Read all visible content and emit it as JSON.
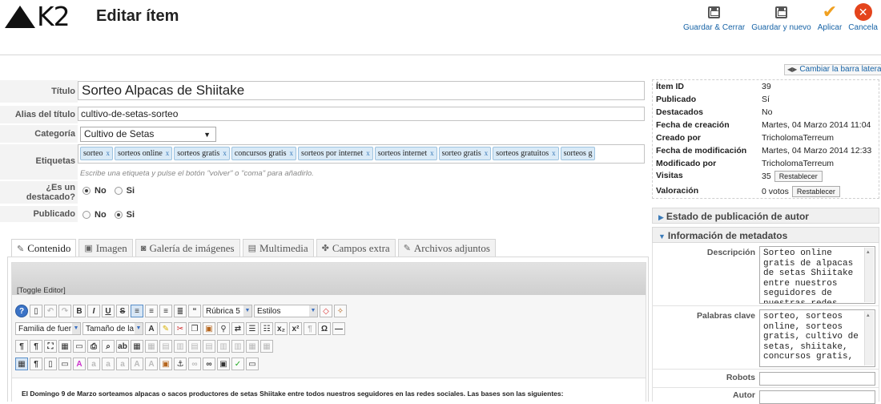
{
  "header": {
    "logo_text": "K2",
    "title": "Editar ítem",
    "toolbar": [
      {
        "label": "Guardar & Cerrar",
        "icon": "save-icon"
      },
      {
        "label": "Guardar y nuevo",
        "icon": "save-icon"
      },
      {
        "label": "Aplicar",
        "icon": "check-icon"
      },
      {
        "label": "Cancela",
        "icon": "cancel-icon"
      }
    ]
  },
  "sidebar_toggle": "Cambiar la barra lateral",
  "form": {
    "title_label": "Título",
    "title_value": "Sorteo Alpacas de Shiitake",
    "alias_label": "Alias del título",
    "alias_value": "cultivo-de-setas-sorteo",
    "category_label": "Categoría",
    "category_value": "Cultivo de Setas",
    "tags_label": "Etiquetas",
    "tags": [
      "sorteo",
      "sorteos online",
      "sorteos gratis",
      "concursos gratis",
      "sorteos por internet",
      "sorteos internet",
      "sorteo gratis",
      "sorteos gratuitos",
      "sorteos g"
    ],
    "tag_remove": "x",
    "tags_hint": "Escribe una etiqueta y pulse el botón \"volver\" o \"coma\" para añadirlo.",
    "featured_label_1": "¿Es un",
    "featured_label_2": "destacado?",
    "featured_no": "No",
    "featured_yes": "Si",
    "published_label": "Publicado",
    "published_no": "No",
    "published_yes": "Si"
  },
  "tabs": [
    {
      "label": "Contenido",
      "icon": "edit-icon"
    },
    {
      "label": "Imagen",
      "icon": "image-icon"
    },
    {
      "label": "Galería de imágenes",
      "icon": "camera-icon"
    },
    {
      "label": "Multimedia",
      "icon": "film-icon"
    },
    {
      "label": "Campos extra",
      "icon": "puzzle-icon"
    },
    {
      "label": "Archivos adjuntos",
      "icon": "paperclip-icon"
    }
  ],
  "editor": {
    "toggle_label": "[Toggle Editor]",
    "format_value": "Rúbrica 5",
    "styles_value": "Estilos",
    "font_family": "Familia de fuer",
    "font_size": "Tamaño de la f",
    "content_text": "El Domingo 9 de Marzo sorteamos alpacas o sacos productores de setas Shiitake entre todos nuestros seguidores en las redes sociales. Las bases son las siguientes:"
  },
  "info": {
    "rows": [
      {
        "key": "Ítem ID",
        "value": "39"
      },
      {
        "key": "Publicado",
        "value": "Sí"
      },
      {
        "key": "Destacados",
        "value": "No"
      },
      {
        "key": "Fecha de creación",
        "value": "Martes, 04 Marzo 2014 11:04"
      },
      {
        "key": "Creado por",
        "value": "TricholomaTerreum"
      },
      {
        "key": "Fecha de modificación",
        "value": "Martes, 04 Marzo 2014 12:33"
      },
      {
        "key": "Modificado por",
        "value": "TricholomaTerreum"
      }
    ],
    "visits_label": "Visitas",
    "visits_value": "35",
    "rating_label": "Valoración",
    "rating_value": "0 votos",
    "reset_label": "Restablecer"
  },
  "panels": {
    "author_state": "Estado de publicación de autor",
    "metadata": "Información de metadatos"
  },
  "metadata": {
    "desc_label": "Descripción",
    "desc_value": "Sorteo online gratis de alpacas de setas Shiitake entre nuestros seguidores de nuestras redes",
    "keywords_label": "Palabras clave",
    "keywords_value": "sorteo, sorteos online, sorteos gratis, cultivo de setas, shiitake, concursos gratis,",
    "robots_label": "Robots",
    "author_label": "Autor"
  }
}
